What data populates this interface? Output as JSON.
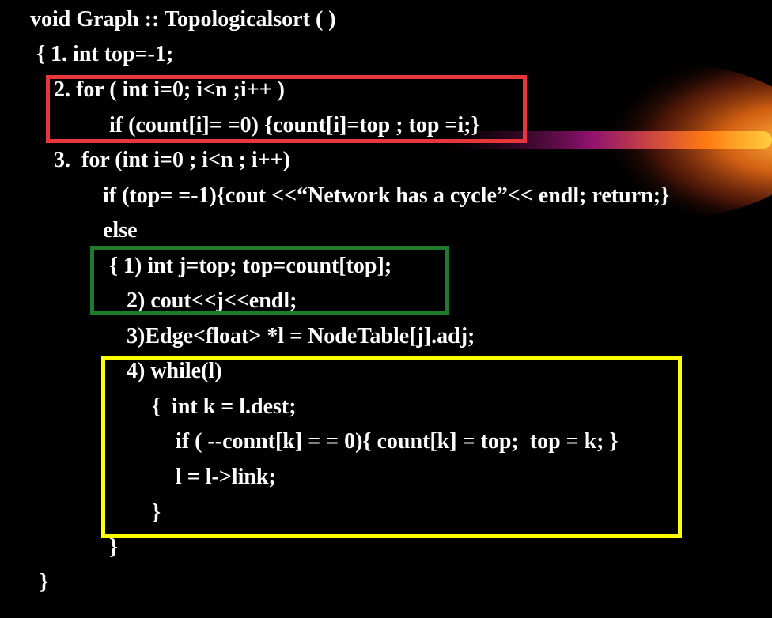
{
  "code": {
    "header": "void Graph :: Topologicalsort ( )",
    "lines": [
      "{ 1. int top=-1;",
      "2. for ( int i=0; i<n ;i++ )",
      "if (count[i]= =0) {count[i]=top ; top =i;}",
      "3.  for (int i=0 ; i<n ; i++)",
      "if (top= =-1){cout <<“Network has a cycle”<< endl; return;}",
      "else",
      "{ 1) int j=top; top=count[top];",
      "2) cout<<j<<endl;",
      "3)Edge<float> *l = NodeTable[j].adj;",
      "4) while(l)",
      "{  int k = l.dest;",
      "if ( --connt[k] = = 0){ count[k] = top;  top = k; }",
      "l = l->link;",
      "}",
      "}",
      "}"
    ]
  },
  "highlights": {
    "red": "#e8363a",
    "green": "#1e7a2c",
    "yellow": "#ffff00"
  },
  "colors": {
    "background": "#000000",
    "text": "#ffffff",
    "glow_core": "#ff8a1a",
    "glow_edge": "#5a1a0a"
  }
}
